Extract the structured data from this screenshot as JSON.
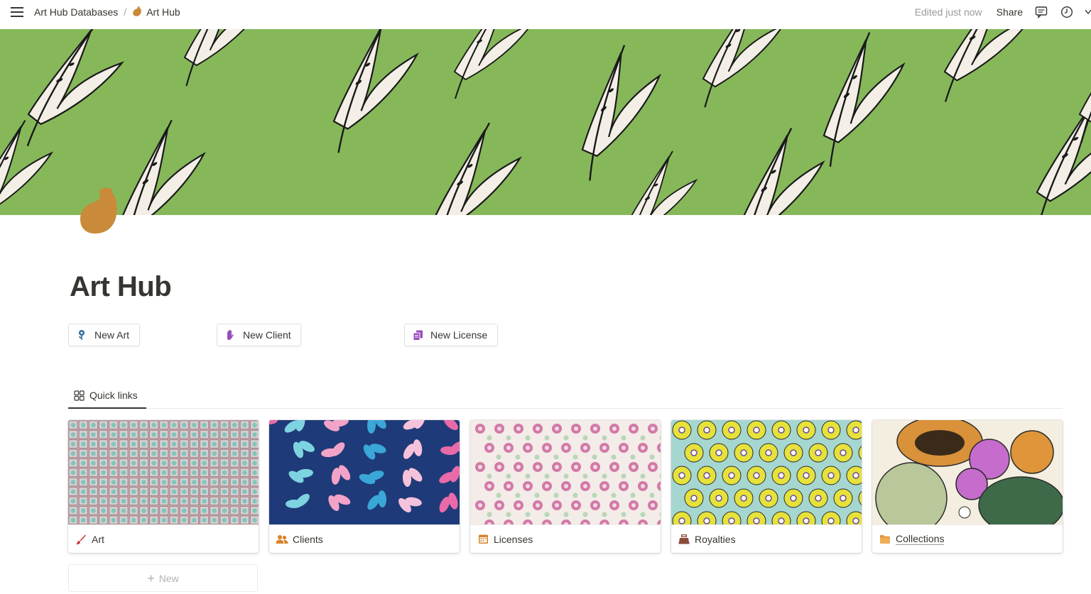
{
  "topbar": {
    "menu_icon": "hamburger-icon",
    "breadcrumbs": [
      {
        "label": "Art Hub Databases"
      },
      {
        "label": "Art Hub",
        "icon": "page-icon"
      }
    ],
    "separator": "/",
    "edited": "Edited just now",
    "share": "Share",
    "icons": [
      "comment-icon",
      "clock-icon",
      "chevron-icon"
    ]
  },
  "page": {
    "title": "Art Hub",
    "cover_color": "#86b85a",
    "icon_color": "#c98a3a"
  },
  "buttons": [
    {
      "label": "New Art",
      "icon": "flower-icon"
    },
    {
      "label": "New Client",
      "icon": "hand-icon"
    },
    {
      "label": "New License",
      "icon": "documents-icon"
    }
  ],
  "tabs": [
    {
      "label": "Quick links",
      "icon": "gallery-icon",
      "active": true
    }
  ],
  "gallery": {
    "cards": [
      {
        "label": "Art",
        "icon": "brush-icon"
      },
      {
        "label": "Clients",
        "icon": "people-icon"
      },
      {
        "label": "Licenses",
        "icon": "calendar-icon"
      },
      {
        "label": "Royalties",
        "icon": "cash-register-icon"
      },
      {
        "label": "Collections",
        "icon": "folder-icon"
      }
    ],
    "new_label": "New"
  }
}
